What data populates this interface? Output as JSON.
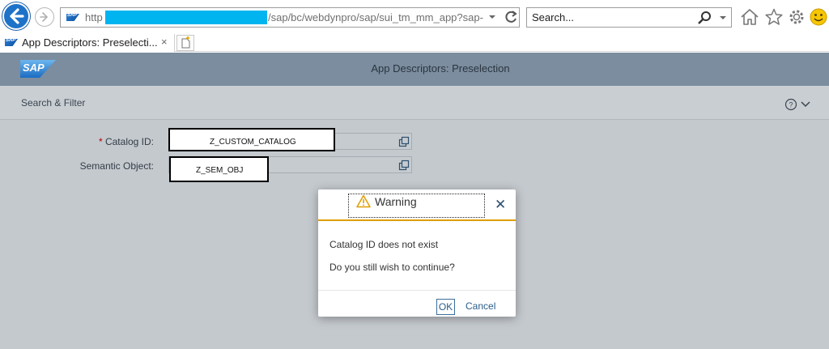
{
  "browser": {
    "url_prefix": "http",
    "url_rest": "/sap/bc/webdynpro/sap/sui_tm_mm_app?sap-",
    "search_placeholder": "Search...",
    "tab_title": "App Descriptors: Preselecti...",
    "tab_close": "×",
    "favicon_text": "SAP"
  },
  "shell": {
    "logo_text": "SAP",
    "title": "App Descriptors: Preselection"
  },
  "filterbar": {
    "title": "Search & Filter",
    "help_glyph": "?"
  },
  "fields": [
    {
      "required_mark": "*",
      "label": "Catalog ID:",
      "value": "Z_CUSTOM_CATALOG"
    },
    {
      "label": "Semantic Object:",
      "value": "Z_SEM_OBJ"
    }
  ],
  "dialog": {
    "title": "Warning",
    "close_glyph": "✕",
    "message_1": "Catalog ID does not exist",
    "message_2": "Do you still wish to continue?",
    "ok_label": "OK",
    "cancel_label": "Cancel"
  },
  "colors": {
    "shell_header": "#7b8d9e",
    "warning_accent": "#e09d00",
    "link_blue": "#2a5d8a",
    "url_redaction": "#00b4f0"
  }
}
